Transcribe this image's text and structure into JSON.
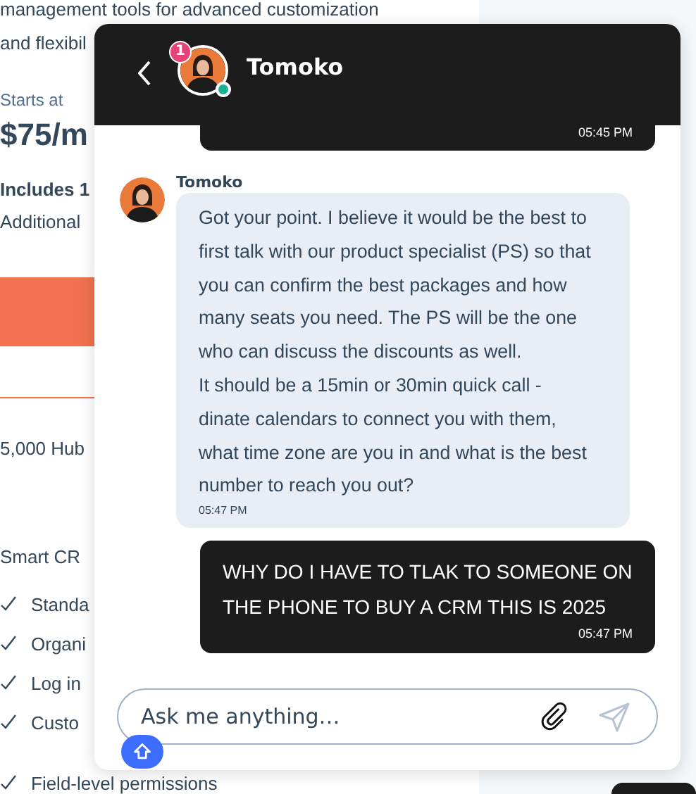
{
  "page": {
    "items": [
      {
        "kind": "text",
        "text": "management tools for advanced customization"
      },
      {
        "kind": "text",
        "text": "and flexibil"
      },
      {
        "kind": "label",
        "text": "Starts at"
      },
      {
        "kind": "price",
        "text": "$75/m"
      },
      {
        "kind": "bold",
        "text": "Includes 1"
      },
      {
        "kind": "text",
        "text": "Additional"
      },
      {
        "kind": "button"
      },
      {
        "kind": "outline_button"
      },
      {
        "kind": "text",
        "text": "5,000 Hub"
      },
      {
        "kind": "section",
        "text": "Smart CR"
      },
      {
        "kind": "check",
        "text": "Standa"
      },
      {
        "kind": "check",
        "text": "Organi"
      },
      {
        "kind": "check",
        "text": "Log in"
      },
      {
        "kind": "check",
        "text": "Custo"
      },
      {
        "kind": "check",
        "text": "Field-level permissions"
      }
    ]
  },
  "chat": {
    "header": {
      "title": "Tomoko",
      "unread": "1",
      "online": true
    },
    "messages": [
      {
        "kind": "outgoing",
        "time": "05:45 PM"
      },
      {
        "kind": "incoming",
        "sender": "Tomoko",
        "text": "Got your point. I believe it would be the best to\nfirst talk with our product specialist (PS) so that\nyou can confirm the best packages and how\nmany seats you need. The PS will be the one\nwho can discuss the discounts as well.\nIt should be a 15min or 30min quick call -\ndinate calendars to connect you with them,\nwhat time zone are you in and what is the best\nnumber to reach you out?",
        "time": "05:47 PM"
      },
      {
        "kind": "outgoing",
        "text": "WHY DO I HAVE TO TLAK TO SOMEONE ON THE PHONE TO BUY A CRM THIS IS 2025",
        "time": "05:47 PM"
      }
    ],
    "input": {
      "placeholder": "Ask me anything…"
    }
  }
}
